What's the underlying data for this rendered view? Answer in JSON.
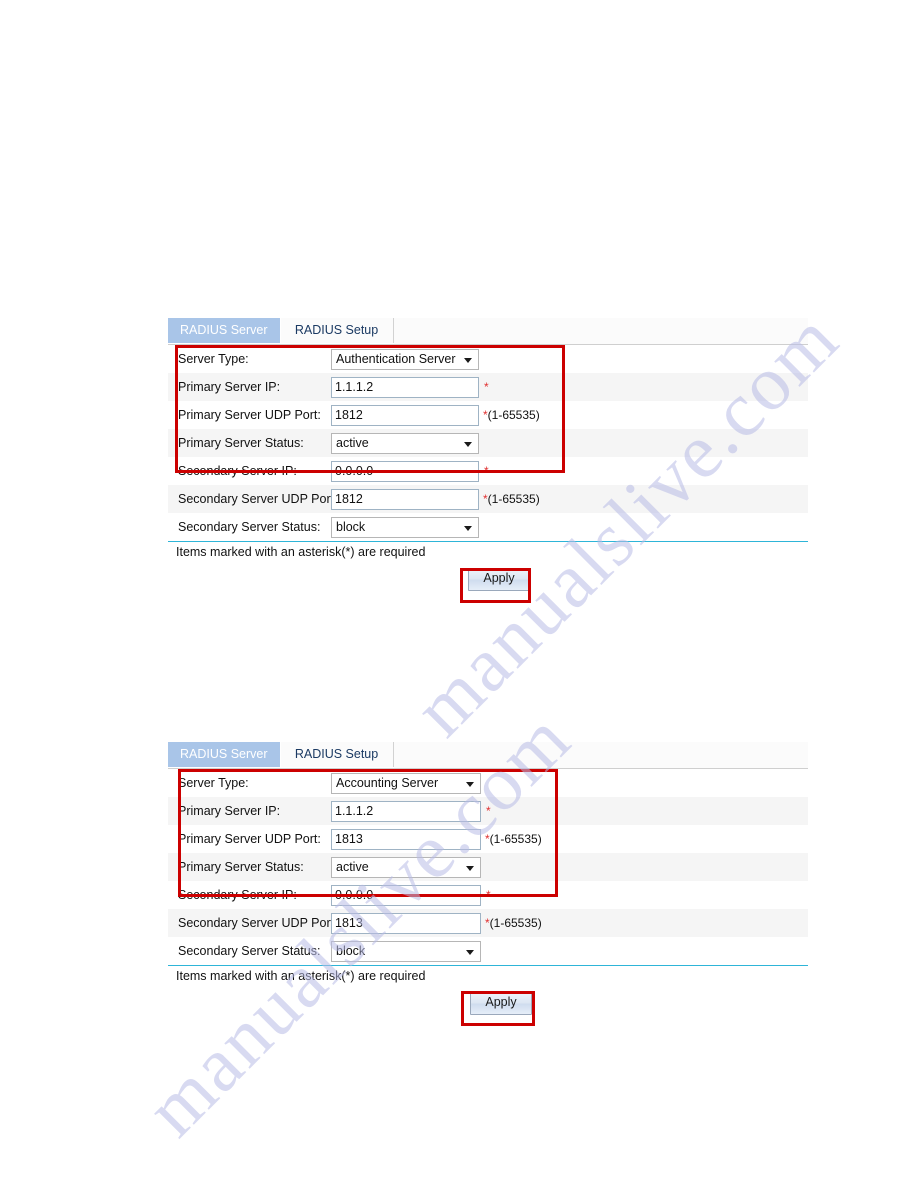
{
  "watermark": {
    "line1": "manualslive.com",
    "line2": "manualslive.com"
  },
  "panels": [
    {
      "id": "authentication",
      "tabs": [
        {
          "label": "RADIUS Server",
          "active": true
        },
        {
          "label": "RADIUS Setup",
          "active": false
        }
      ],
      "rows": [
        {
          "label": "Server Type:",
          "control": "dropdown",
          "value": "Authentication Server",
          "hint": ""
        },
        {
          "label": "Primary Server IP:",
          "control": "textbox",
          "value": "1.1.1.2",
          "hint": "*"
        },
        {
          "label": "Primary Server UDP Port:",
          "control": "textbox",
          "value": "1812",
          "hint": "*(1-65535)"
        },
        {
          "label": "Primary Server Status:",
          "control": "dropdown",
          "value": "active",
          "hint": ""
        },
        {
          "label": "Secondary Server IP:",
          "control": "textbox",
          "value": "0.0.0.0",
          "hint": "*"
        },
        {
          "label": "Secondary Server UDP Port:",
          "control": "textbox",
          "value": "1812",
          "hint": "*(1-65535)"
        },
        {
          "label": "Secondary Server Status:",
          "control": "dropdown",
          "value": "block",
          "hint": ""
        }
      ],
      "required_note": "Items marked with an asterisk(*) are required",
      "apply_label": "Apply"
    },
    {
      "id": "accounting",
      "tabs": [
        {
          "label": "RADIUS Server",
          "active": true
        },
        {
          "label": "RADIUS Setup",
          "active": false
        }
      ],
      "rows": [
        {
          "label": "Server Type:",
          "control": "dropdown",
          "value": "Accounting Server",
          "hint": ""
        },
        {
          "label": "Primary Server IP:",
          "control": "textbox",
          "value": "1.1.1.2",
          "hint": "*"
        },
        {
          "label": "Primary Server UDP Port:",
          "control": "textbox",
          "value": "1813",
          "hint": "*(1-65535)"
        },
        {
          "label": "Primary Server Status:",
          "control": "dropdown",
          "value": "active",
          "hint": ""
        },
        {
          "label": "Secondary Server IP:",
          "control": "textbox",
          "value": "0.0.0.0",
          "hint": "*"
        },
        {
          "label": "Secondary Server UDP Port:",
          "control": "textbox",
          "value": "1813",
          "hint": "*(1-65535)"
        },
        {
          "label": "Secondary Server Status:",
          "control": "dropdown",
          "value": "block",
          "hint": ""
        }
      ],
      "required_note": "Items marked with an asterisk(*) are required",
      "apply_label": "Apply"
    }
  ],
  "colors": {
    "annotation_red": "#cc0000",
    "active_tab_bg": "#a9c5e8",
    "divider_cyan": "#2eb5d8",
    "required_star": "#e03030",
    "row_alt_bg": "#f5f5f5",
    "watermark": "#b9bce6"
  }
}
